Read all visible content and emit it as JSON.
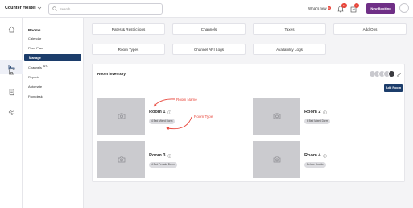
{
  "app": {
    "name": "Counter Hostel"
  },
  "header": {
    "search_placeholder": "Search",
    "whats_new_label": "What's new",
    "whats_new_count": "1",
    "notifications_count": "10",
    "tasks_count": "2",
    "new_booking_label": "New Booking"
  },
  "rail": {
    "icons": [
      "home-icon",
      "bed-icon",
      "building-icon",
      "receipt-icon",
      "handshake-icon"
    ]
  },
  "subnav": {
    "title": "Rooms",
    "items": [
      {
        "label": "Calendar"
      },
      {
        "label": "Floor Plan"
      },
      {
        "label": "Manage"
      },
      {
        "label": "Channels",
        "badge": "BETA"
      },
      {
        "label": "Reports"
      },
      {
        "label": "Automate"
      },
      {
        "label": "Frontdesk"
      }
    ]
  },
  "tabs": {
    "row1": [
      "Rates & Restrictions",
      "Channels",
      "Taxes",
      "Add Ons"
    ],
    "row2": [
      "Room Types",
      "Channel ARI Logs",
      "Availability Logs"
    ]
  },
  "inventory": {
    "title": "Room inventory",
    "add_room_label": "Add Room",
    "annotations": {
      "name": "Room Name",
      "type": "Room Type"
    },
    "rooms": [
      {
        "name": "Room 1",
        "type": "4 Bed Mixed Dorm"
      },
      {
        "name": "Room 2",
        "type": "6 Bed Mixed Dorm"
      },
      {
        "name": "Room 3",
        "type": "4 Bed Female Dorm"
      },
      {
        "name": "Room 4",
        "type": "Deluxe Double"
      }
    ]
  },
  "colors": {
    "brand_purple": "#6f2f86",
    "nav_active": "#1c3d6b",
    "annotation_red": "#e8463b"
  }
}
